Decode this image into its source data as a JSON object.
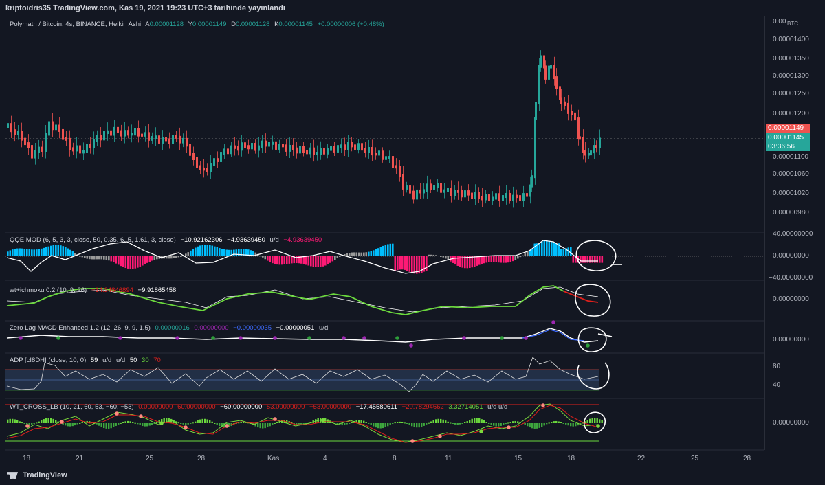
{
  "header": {
    "publish_line": "kriptoidris35 TradingView.com, Kas 19, 2021 19:23 UTC+3 tarihinde yayınlandı"
  },
  "main": {
    "symbol": "Polymath / Bitcoin, 4s, BINANCE, Heikin Ashi",
    "ohlc": {
      "a_label": "A",
      "a_value": "0.00001128",
      "y_label": "Y",
      "y_value": "0.00001149",
      "d_label": "D",
      "d_value": "0.00001128",
      "k_label": "K",
      "k_value": "0.00001145",
      "change": "+0.00000006 (+0.48%)"
    },
    "axis_unit": "BTC",
    "price_labels": [
      "0.00 ",
      "0.00001400",
      "0.00001350",
      "0.00001300",
      "0.00001250",
      "0.00001200",
      "0.00001100",
      "0.00001060",
      "0.00001020",
      "0.00000980"
    ],
    "last_price_red": "0.00001149",
    "last_price_green": "0.00001145",
    "countdown": "03:36:56"
  },
  "indicators": {
    "qqe": {
      "name": "QQE MOD (6, 5, 3, 3, close, 50, 0.35, 6, 5, 1.61, 3, close)",
      "v1": "−10.92162306",
      "v2": "−4.93639450",
      "ud": "u/d",
      "v3": "−4.93639450",
      "ax_top": "40.00000000",
      "ax_mid": "0.00000000",
      "ax_bot": "−40.00000000"
    },
    "wt_ichimoku": {
      "name": "wt+ichmoku 0.2 (10, 9, 26)",
      "v1": "−14.34846894",
      "v2": "−9.91865458",
      "ax_mid": "0.00000000"
    },
    "zlmacd": {
      "name": "Zero Lag MACD Enhanced 1.2 (12, 26, 9, 9, 1.5)",
      "v1": "0.00000016",
      "v2": "0.00000000",
      "v3": "−0.00000035",
      "v4": "−0.00000051",
      "ud": "u/d",
      "ax_mid": "0.00000000"
    },
    "adp": {
      "name": "ADP [cI8DH] (close, 10, 0)",
      "v1": "59",
      "ud1": "u/d",
      "ud2": "u/d",
      "v2": "50",
      "v3": "30",
      "v4": "70",
      "ax_80": "80",
      "ax_40": "40"
    },
    "wt_cross": {
      "name": "WT_CROSS_LB (10, 21, 60, 53, −60, −53)",
      "v1": "0.00000000",
      "v2": "60.00000000",
      "v3": "−60.00000000",
      "v4": "53.00000000",
      "v5": "−53.00000000",
      "v6": "−17.45580611",
      "v7": "−20.78294662",
      "v8": "3.32714051",
      "ud": "u/d u/d",
      "ax_mid": "0.00000000"
    }
  },
  "x_axis": [
    "18",
    "21",
    "25",
    "28",
    "Kas",
    "4",
    "8",
    "11",
    "15",
    "18",
    "22",
    "25",
    "28"
  ],
  "footer": {
    "logo_text": "TradingView"
  },
  "colors": {
    "bg": "#131722",
    "up": "#26a69a",
    "down": "#ef5350",
    "qqe_blue": "#00bfff",
    "qqe_pink": "#ff1a75",
    "grid": "#2a2e39"
  }
}
